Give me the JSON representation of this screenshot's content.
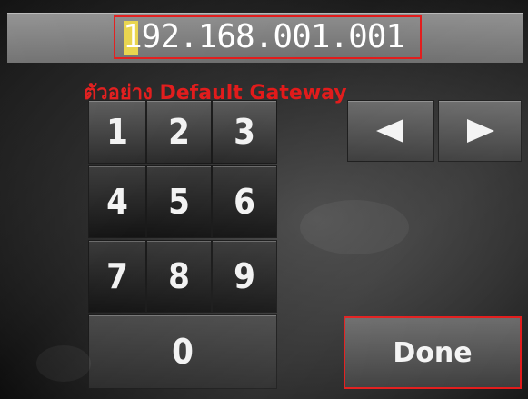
{
  "address_field": {
    "value": "192.168.001.001",
    "highlight_color": "#e21a1a",
    "cursor_color": "#e8d44a"
  },
  "annotation": {
    "caption": "ตัวอย่าง Default Gateway",
    "color": "#e21a1a"
  },
  "keypad": {
    "keys": [
      "1",
      "2",
      "3",
      "4",
      "5",
      "6",
      "7",
      "8",
      "9",
      "0"
    ]
  },
  "navigation": {
    "left_icon": "left-arrow-icon",
    "right_icon": "right-arrow-icon"
  },
  "done_button": {
    "label": "Done"
  }
}
